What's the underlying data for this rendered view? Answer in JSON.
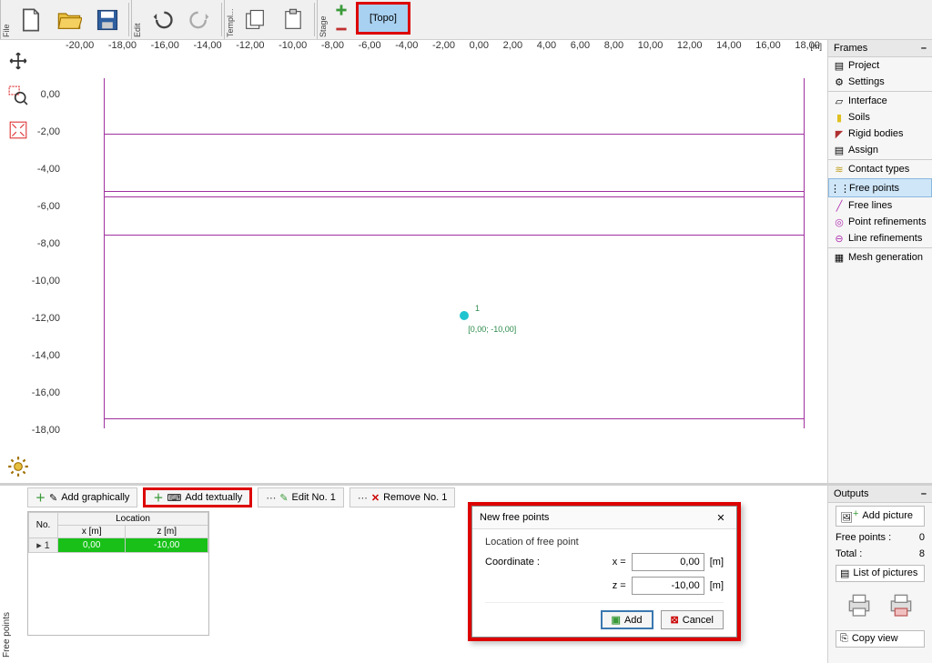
{
  "toolbar": {
    "file_label": "File",
    "edit_label": "Edit",
    "templates_label": "Templ...",
    "stage_label": "Stage",
    "topo_label": "[Topo]"
  },
  "ruler": {
    "top": [
      "-20,00",
      "-18,00",
      "-16,00",
      "-14,00",
      "-12,00",
      "-10,00",
      "-8,00",
      "-6,00",
      "-4,00",
      "-2,00",
      "0,00",
      "2,00",
      "4,00",
      "6,00",
      "8,00",
      "10,00",
      "12,00",
      "14,00",
      "16,00",
      "18,00"
    ],
    "unit": "[m]",
    "left": [
      "0,00",
      "-2,00",
      "-4,00",
      "-6,00",
      "-8,00",
      "-10,00",
      "-12,00",
      "-14,00",
      "-16,00",
      "-18,00"
    ]
  },
  "canvas": {
    "point_number": "1",
    "point_coords": "[0,00; -10,00]"
  },
  "frames_panel": {
    "title": "Frames",
    "items": {
      "project": "Project",
      "settings": "Settings",
      "interface": "Interface",
      "soils": "Soils",
      "rigid_bodies": "Rigid bodies",
      "assign": "Assign",
      "contact_types": "Contact types",
      "free_points": "Free points",
      "free_lines": "Free lines",
      "point_refinements": "Point refinements",
      "line_refinements": "Line refinements",
      "mesh_generation": "Mesh generation"
    }
  },
  "bottom": {
    "add_graphically": "Add graphically",
    "add_textually": "Add textually",
    "edit_no": "Edit No. 1",
    "remove_no": "Remove No. 1",
    "side_label": "Free points",
    "table": {
      "h_no": "No.",
      "h_location": "Location",
      "h_x": "x [m]",
      "h_z": "z [m]",
      "rows": [
        {
          "no": "1",
          "x": "0,00",
          "z": "-10,00"
        }
      ]
    }
  },
  "dialog": {
    "title": "New free points",
    "group": "Location of free point",
    "coord_label": "Coordinate :",
    "x_label": "x =",
    "z_label": "z =",
    "x_value": "0,00",
    "z_value": "-10,00",
    "unit": "[m]",
    "add_btn": "Add",
    "cancel_btn": "Cancel"
  },
  "outputs": {
    "title": "Outputs",
    "add_picture": "Add picture",
    "free_points_label": "Free points :",
    "free_points_value": "0",
    "total_label": "Total :",
    "total_value": "8",
    "list_pictures": "List of pictures",
    "copy_view": "Copy view"
  }
}
